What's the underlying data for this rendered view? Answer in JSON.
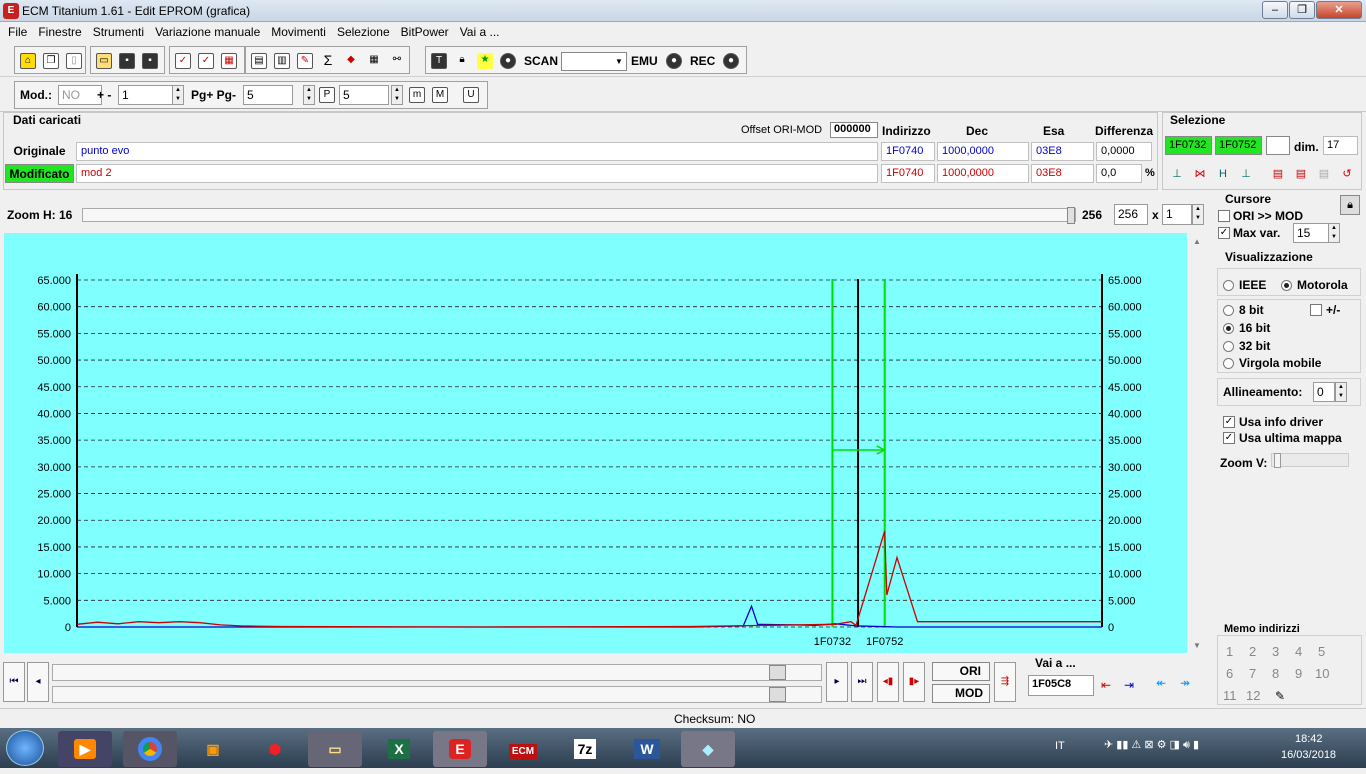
{
  "window": {
    "title": "ECM Titanium 1.61 - Edit EPROM (grafica)",
    "min": "‒",
    "max": "❐",
    "close": "✕"
  },
  "menu": [
    "File",
    "Finestre",
    "Strumenti",
    "Variazione manuale",
    "Movimenti",
    "Selezione",
    "BitPower",
    "Vai a ..."
  ],
  "toolbar": {
    "scan": "SCAN",
    "emu": "EMU",
    "rec": "REC",
    "scan_value": ""
  },
  "toolbar2": {
    "mod_label": "Mod.:",
    "mod_value": "NO",
    "pm_label": "+ -",
    "pm_value": "1",
    "pg_label": "Pg+ Pg-",
    "pg_value": "5",
    "p_value": "5"
  },
  "data": {
    "title": "Dati caricati",
    "offset_label": "Offset ORI-MOD",
    "offset_value": "000000",
    "headers": {
      "indirizzo": "Indirizzo",
      "dec": "Dec",
      "esa": "Esa",
      "differenza": "Differenza"
    },
    "originale": {
      "label": "Originale",
      "name": "punto evo",
      "indirizzo": "1F0740",
      "dec": "1000,0000",
      "esa": "03E8",
      "diff": "0,0000"
    },
    "modificato": {
      "label": "Modificato",
      "name": "mod 2",
      "indirizzo": "1F0740",
      "dec": "1000,0000",
      "esa": "03E8",
      "diff": "0,0",
      "pct": "%"
    }
  },
  "selezione": {
    "title": "Selezione",
    "start": "1F0732",
    "end": "1F0752",
    "extra": "",
    "dim_label": "dim.",
    "dim_value": "17"
  },
  "zoom": {
    "label": "Zoom H: 16",
    "value1": "256",
    "value2": "256",
    "x": "x",
    "mult": "1"
  },
  "chart_data": {
    "type": "line",
    "ylim": [
      0,
      65000
    ],
    "y_ticks": [
      "65.000",
      "60.000",
      "55.000",
      "50.000",
      "45.000",
      "40.000",
      "35.000",
      "30.000",
      "25.000",
      "20.000",
      "15.000",
      "10.000",
      "5.000",
      "0"
    ],
    "x_markers": [
      "1F0732",
      "1F0752"
    ],
    "series": [
      {
        "color": "#0000cc",
        "points": [
          [
            0,
            0
          ],
          [
            0.1,
            0
          ],
          [
            0.2,
            0
          ],
          [
            0.3,
            0
          ],
          [
            0.4,
            0
          ],
          [
            0.5,
            0
          ],
          [
            0.6,
            0
          ],
          [
            0.65,
            200
          ],
          [
            0.658,
            3900
          ],
          [
            0.664,
            500
          ],
          [
            0.7,
            400
          ],
          [
            0.72,
            300
          ],
          [
            0.74,
            600
          ],
          [
            0.76,
            200
          ],
          [
            0.8,
            0
          ],
          [
            1,
            0
          ]
        ]
      },
      {
        "color": "#cc0000",
        "points": [
          [
            0,
            500
          ],
          [
            0.02,
            900
          ],
          [
            0.04,
            600
          ],
          [
            0.06,
            1000
          ],
          [
            0.08,
            800
          ],
          [
            0.1,
            1000
          ],
          [
            0.12,
            800
          ],
          [
            0.14,
            400
          ],
          [
            0.16,
            200
          ],
          [
            0.2,
            100
          ],
          [
            0.4,
            0
          ],
          [
            0.6,
            100
          ],
          [
            0.74,
            500
          ],
          [
            0.755,
            1000
          ],
          [
            0.76,
            300
          ],
          [
            0.788,
            18000
          ],
          [
            0.79,
            6000
          ],
          [
            0.8,
            13000
          ],
          [
            0.82,
            1000
          ],
          [
            0.84,
            1000
          ],
          [
            1,
            1000
          ]
        ]
      }
    ],
    "cursor_fraction": 0.762,
    "sel_start_fraction": 0.737,
    "sel_end_fraction": 0.788
  },
  "cursore": {
    "title": "Cursore",
    "ori_mod": "ORI >> MOD",
    "max_var": "Max var.",
    "max_var_value": "15"
  },
  "visualizzazione": {
    "title": "Visualizzazione",
    "ieee": "IEEE",
    "motorola": "Motorola",
    "b8": "8 bit",
    "pm": "+/-",
    "b16": "16 bit",
    "b32": "32 bit",
    "virgola": "Virgola mobile",
    "allineamento": "Allineamento:",
    "allineamento_value": "0",
    "usa_info": "Usa info driver",
    "usa_ultima": "Usa ultima mappa",
    "zoom_v": "Zoom V:"
  },
  "memo": {
    "title": "Memo indirizzi",
    "items": [
      "1",
      "2",
      "3",
      "4",
      "5",
      "6",
      "7",
      "8",
      "9",
      "10",
      "11",
      "12"
    ]
  },
  "nav": {
    "ori": "ORI",
    "mod": "MOD",
    "vai_label": "Vai a ...",
    "vai_value": "1F05C8"
  },
  "status": {
    "checksum": "Checksum: NO"
  },
  "taskbar": {
    "lang": "IT",
    "time": "18:42",
    "date": "16/03/2018",
    "apps": [
      "media",
      "chrome",
      "wallet",
      "ruby",
      "folder",
      "excel",
      "ecm",
      "ecm2",
      "7z",
      "word",
      "paint"
    ],
    "app_labels": {
      "excel": "X",
      "ecm": "E",
      "ecm2": "ECM",
      "7z": "7z",
      "word": "W"
    }
  }
}
